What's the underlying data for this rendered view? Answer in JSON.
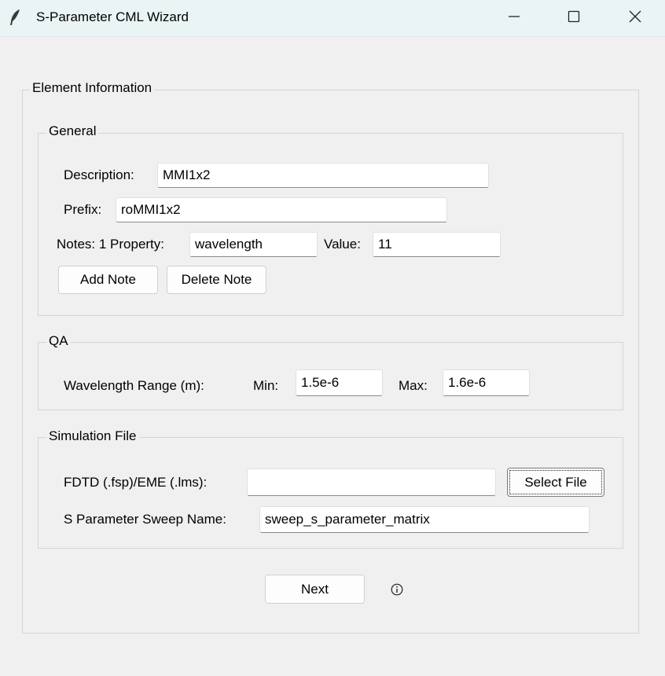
{
  "window": {
    "title": "S-Parameter CML Wizard",
    "icon": "feather-icon",
    "controls": [
      "minimize-icon",
      "maximize-icon",
      "close-icon"
    ]
  },
  "element_info": {
    "legend": "Element Information",
    "general": {
      "legend": "General",
      "description_label": "Description:",
      "description_value": "MMI1x2",
      "prefix_label": "Prefix:",
      "prefix_value": "roMMI1x2",
      "notes_label": "Notes: 1 Property:",
      "property_value": "wavelength",
      "value_label": "Value:",
      "value_value": "11",
      "add_note_label": "Add Note",
      "delete_note_label": "Delete Note"
    },
    "qa": {
      "legend": "QA",
      "range_label": "Wavelength Range (m):",
      "min_label": "Min:",
      "min_value": "1.5e-6",
      "max_label": "Max:",
      "max_value": "1.6e-6"
    },
    "sim_file": {
      "legend": "Simulation File",
      "fdtd_label": "FDTD (.fsp)/EME (.lms):",
      "fdtd_value": "",
      "select_file_label": "Select File",
      "sweep_label": "S Parameter Sweep Name:",
      "sweep_value": "sweep_s_parameter_matrix"
    }
  },
  "footer": {
    "next_label": "Next",
    "info_icon": "info-icon"
  }
}
